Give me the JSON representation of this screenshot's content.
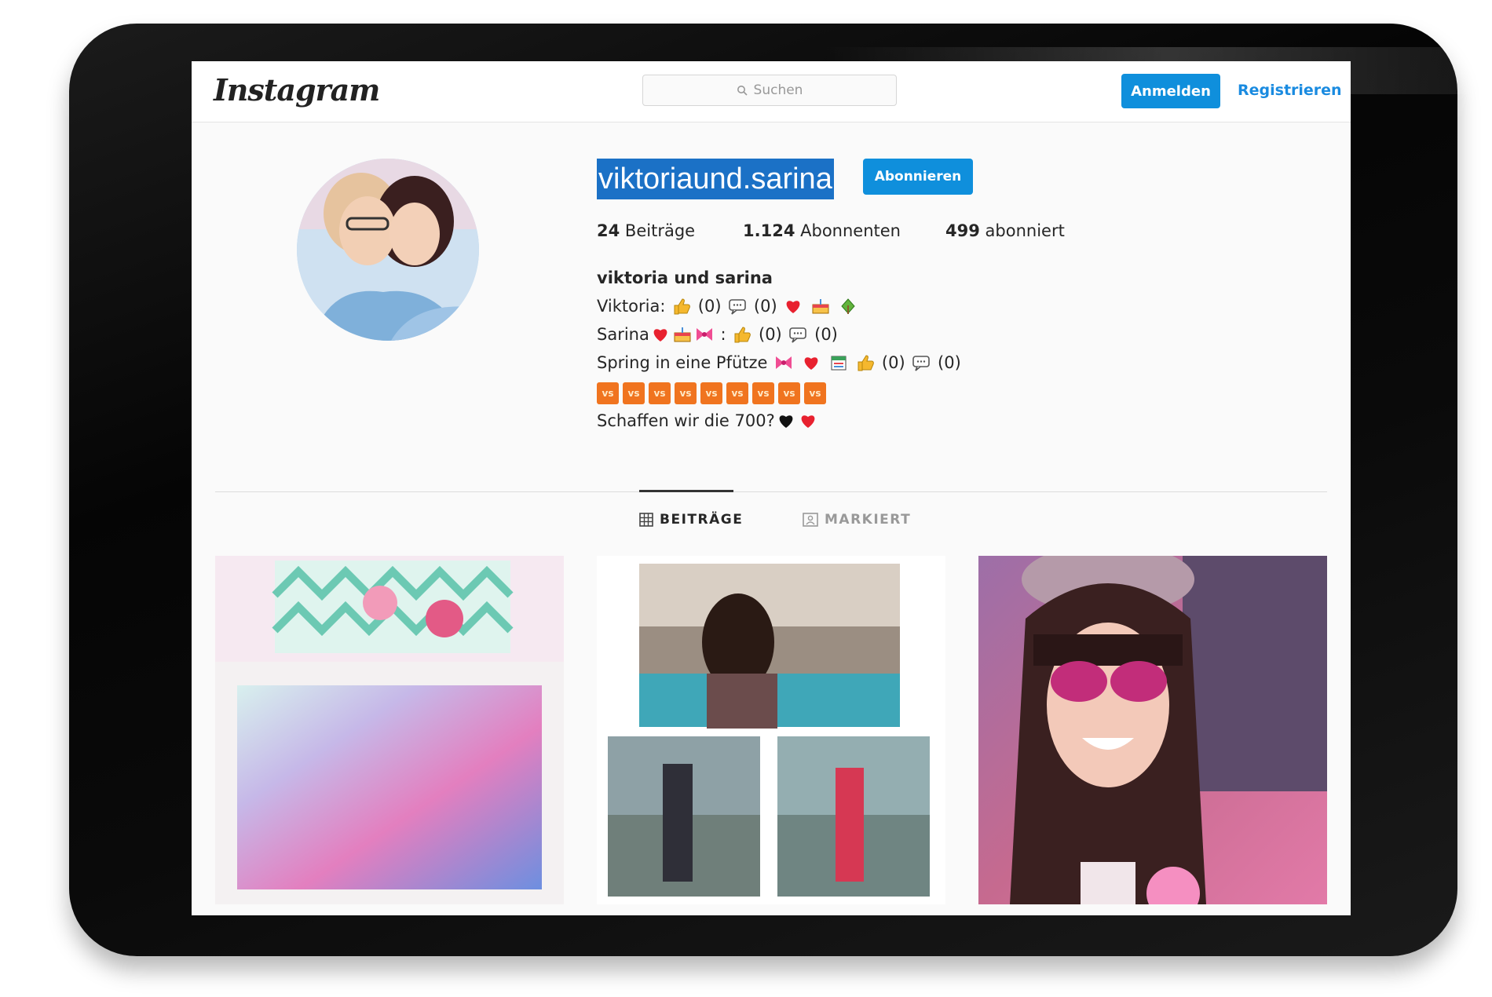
{
  "header": {
    "logo": "Instagram",
    "search_placeholder": "Suchen",
    "login_label": "Anmelden",
    "register_label": "Registrieren"
  },
  "profile": {
    "username": "viktoriaund.sarina",
    "follow_label": "Abonnieren",
    "stats": {
      "posts_count": "24",
      "posts_label": "Beiträge",
      "followers_count": "1.124",
      "followers_label": "Abonnenten",
      "following_count": "499",
      "following_label": "abonniert"
    },
    "bio": {
      "name": "viktoria und sarina",
      "line1_text": "Viktoria:",
      "line2_text": "Sarina",
      "line3_text": "Spring in eine Pfütze",
      "count_zero": "(0)",
      "colon": ":",
      "vs_label": "vs",
      "line5_text": "Schaffen wir die 700?"
    }
  },
  "tabs": {
    "posts": "BEITRÄGE",
    "tagged": "MARKIERT"
  },
  "colors": {
    "accent_blue": "#0f8fdc",
    "selection_blue": "#1b71c6",
    "link_blue": "#1a8be0"
  }
}
